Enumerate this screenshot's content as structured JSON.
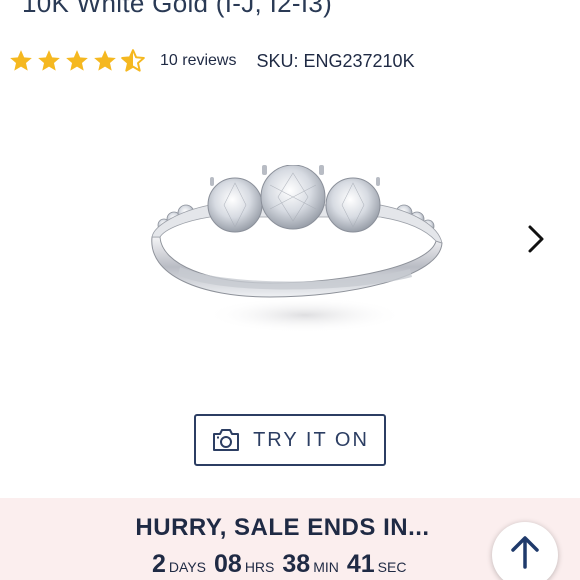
{
  "product": {
    "title_line": "10K White Gold (I-J, I2-I3)",
    "rating_stars": 4.5,
    "reviews_label": "10 reviews",
    "sku_label": "SKU: ENG237210K"
  },
  "try_on": {
    "label": "TRY IT ON"
  },
  "sale": {
    "title": "HURRY, SALE ENDS IN...",
    "countdown": [
      {
        "value": "2",
        "unit": "DAYS"
      },
      {
        "value": "08",
        "unit": "HRS"
      },
      {
        "value": "38",
        "unit": "MIN"
      },
      {
        "value": "41",
        "unit": "SEC"
      }
    ]
  },
  "icons": {
    "star": "star-icon",
    "next": "chevron-right-icon",
    "camera": "camera-icon",
    "scroll_top": "arrow-up-icon"
  },
  "colors": {
    "star": "#f5b820",
    "text_navy": "#1f2a44",
    "banner_bg": "#fbeeee"
  }
}
